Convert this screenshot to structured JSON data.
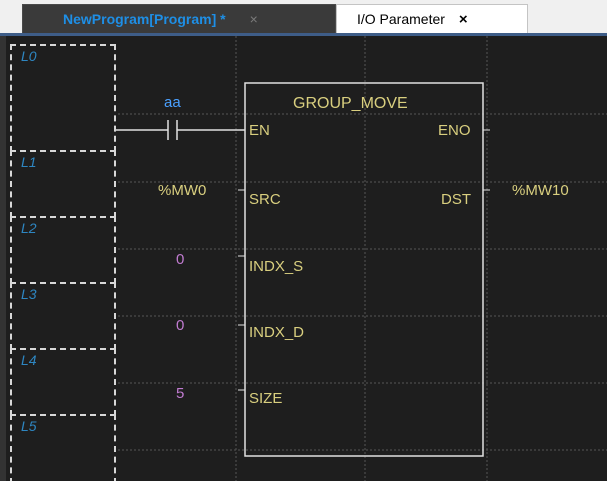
{
  "tabs": [
    {
      "label": "NewProgram[Program] *",
      "close": "×",
      "active": true
    },
    {
      "label": "I/O Parameter",
      "close": "×",
      "active": false
    }
  ],
  "rungs": [
    "L0",
    "L1",
    "L2",
    "L3",
    "L4",
    "L5"
  ],
  "contact": {
    "name": "aa"
  },
  "function_block": {
    "name": "GROUP_MOVE",
    "inputs": [
      "EN",
      "SRC",
      "INDX_S",
      "INDX_D",
      "SIZE"
    ],
    "outputs": [
      "ENO",
      "DST"
    ]
  },
  "operands": {
    "src": "%MW0",
    "indx_s": "0",
    "indx_d": "0",
    "size": "5",
    "dst": "%MW10"
  },
  "colors": {
    "active_tab_text": "#1e8fe6",
    "rung_label": "#2e86c1",
    "block_text": "#d9cf7f",
    "constant": "#c07bd0",
    "contact_name": "#4aa0ff"
  }
}
